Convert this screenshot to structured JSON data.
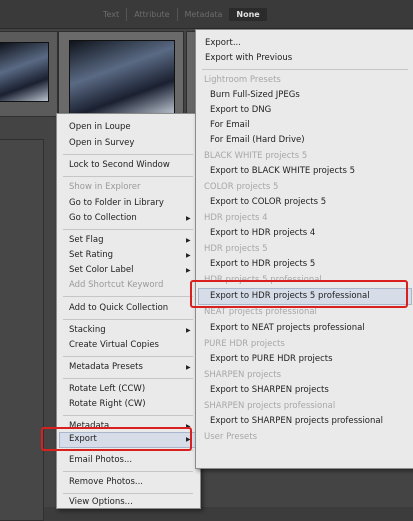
{
  "filter_bar": {
    "tabs": [
      {
        "label": "Text",
        "active": false
      },
      {
        "label": "Attribute",
        "active": false
      },
      {
        "label": "Metadata",
        "active": false
      },
      {
        "label": "None",
        "active": true
      }
    ]
  },
  "context_menu": {
    "items": [
      {
        "label": "Open in Loupe",
        "disabled": false,
        "submenu": false
      },
      {
        "label": "Open in Survey",
        "disabled": false,
        "submenu": false
      },
      {
        "label": "Lock to Second Window",
        "disabled": false,
        "submenu": false
      },
      {
        "label": "Show in Explorer",
        "disabled": true,
        "submenu": false
      },
      {
        "label": "Go to Folder in Library",
        "disabled": false,
        "submenu": false
      },
      {
        "label": "Go to Collection",
        "disabled": false,
        "submenu": true
      },
      {
        "label": "Set Flag",
        "disabled": false,
        "submenu": true
      },
      {
        "label": "Set Rating",
        "disabled": false,
        "submenu": true
      },
      {
        "label": "Set Color Label",
        "disabled": false,
        "submenu": true
      },
      {
        "label": "Add Shortcut Keyword",
        "disabled": true,
        "submenu": false
      },
      {
        "label": "Add to Quick Collection",
        "disabled": false,
        "submenu": false
      },
      {
        "label": "Stacking",
        "disabled": false,
        "submenu": true
      },
      {
        "label": "Create Virtual Copies",
        "disabled": false,
        "submenu": false
      },
      {
        "label": "Metadata Presets",
        "disabled": false,
        "submenu": true
      },
      {
        "label": "Rotate Left (CCW)",
        "disabled": false,
        "submenu": false
      },
      {
        "label": "Rotate Right (CW)",
        "disabled": false,
        "submenu": false
      },
      {
        "label": "Metadata",
        "disabled": false,
        "submenu": true
      },
      {
        "label": "Export",
        "disabled": false,
        "submenu": true,
        "highlighted": true
      },
      {
        "label": "Email Photos...",
        "disabled": false,
        "submenu": false
      },
      {
        "label": "Remove Photos...",
        "disabled": false,
        "submenu": false
      },
      {
        "label": "View Options...",
        "disabled": false,
        "submenu": false
      }
    ]
  },
  "export_submenu": {
    "items": [
      {
        "label": "Export...",
        "kind": "item"
      },
      {
        "label": "Export with Previous",
        "kind": "item"
      },
      {
        "label": "Lightroom Presets",
        "kind": "header"
      },
      {
        "label": "Burn Full-Sized JPEGs",
        "kind": "sub"
      },
      {
        "label": "Export to DNG",
        "kind": "sub"
      },
      {
        "label": "For Email",
        "kind": "sub"
      },
      {
        "label": "For Email (Hard Drive)",
        "kind": "sub"
      },
      {
        "label": "BLACK WHITE projects 5",
        "kind": "header"
      },
      {
        "label": "Export to BLACK WHITE projects 5",
        "kind": "sub"
      },
      {
        "label": "COLOR projects 5",
        "kind": "header"
      },
      {
        "label": "Export to COLOR projects 5",
        "kind": "sub"
      },
      {
        "label": "HDR projects 4",
        "kind": "header"
      },
      {
        "label": "Export to HDR projects 4",
        "kind": "sub"
      },
      {
        "label": "HDR projects 5",
        "kind": "header"
      },
      {
        "label": "Export to HDR projects 5",
        "kind": "sub"
      },
      {
        "label": "HDR projects 5 professional",
        "kind": "header"
      },
      {
        "label": "Export to HDR projects 5 professional",
        "kind": "sub",
        "highlighted": true
      },
      {
        "label": "NEAT projects professional",
        "kind": "header"
      },
      {
        "label": "Export to NEAT projects professional",
        "kind": "sub"
      },
      {
        "label": "PURE HDR projects",
        "kind": "header"
      },
      {
        "label": "Export to PURE HDR projects",
        "kind": "sub"
      },
      {
        "label": "SHARPEN projects",
        "kind": "header"
      },
      {
        "label": "Export to SHARPEN projects",
        "kind": "sub"
      },
      {
        "label": "SHARPEN projects professional",
        "kind": "header"
      },
      {
        "label": "Export to SHARPEN projects professional",
        "kind": "sub"
      },
      {
        "label": "User Presets",
        "kind": "header"
      }
    ]
  },
  "colors": {
    "highlight_border": "#d9201e",
    "menu_bg": "#eaeaea"
  }
}
